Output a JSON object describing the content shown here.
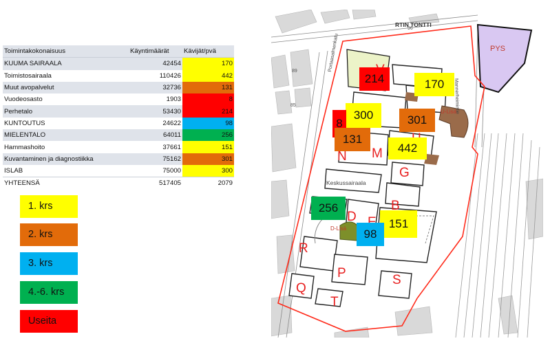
{
  "table": {
    "headers": [
      "Toimintakokonaisuus",
      "Käyntimäärät",
      "Kävijät/pvä"
    ],
    "rows": [
      {
        "name": "KUUMA SAIRAALA",
        "visits": "42454",
        "per_day": "170",
        "color": "#ffff00"
      },
      {
        "name": "Toimistosairaala",
        "visits": "110426",
        "per_day": "442",
        "color": "#ffff00"
      },
      {
        "name": "Muut avopalvelut",
        "visits": "32736",
        "per_day": "131",
        "color": "#e26b0a"
      },
      {
        "name": "Vuodeosasto",
        "visits": "1903",
        "per_day": "8",
        "color": "#ff0000"
      },
      {
        "name": "Perhetalo",
        "visits": "53430",
        "per_day": "214",
        "color": "#ff0000"
      },
      {
        "name": "KUNTOUTUS",
        "visits": "24622",
        "per_day": "98",
        "color": "#00b0f0"
      },
      {
        "name": "MIELENTALO",
        "visits": "64011",
        "per_day": "256",
        "color": "#00b050"
      },
      {
        "name": "Hammashoito",
        "visits": "37661",
        "per_day": "151",
        "color": "#ffff00"
      },
      {
        "name": "Kuvantaminen ja diagnostiikka",
        "visits": "75162",
        "per_day": "301",
        "color": "#e26b0a"
      },
      {
        "name": "ISLAB",
        "visits": "75000",
        "per_day": "300",
        "color": "#ffff00"
      }
    ],
    "total": {
      "name": "YHTEENSÄ",
      "visits": "517405",
      "per_day": "2079"
    }
  },
  "legend": [
    {
      "label": "1. krs",
      "color": "#ffff00"
    },
    {
      "label": "2. krs",
      "color": "#e26b0a"
    },
    {
      "label": "3. krs",
      "color": "#00b0f0"
    },
    {
      "label": "4.-6. krs",
      "color": "#00b050"
    },
    {
      "label": "Useita",
      "color": "#ff0000"
    }
  ],
  "map": {
    "street_top": "RTIN TONTTI",
    "street_left": "Portaasalmenkatu",
    "street_right": "Mannerheimintie",
    "area_label": "PYS",
    "hospital_label": "Keskussairaala",
    "lisa_labels": [
      "U-Lisä",
      "D-Lisä"
    ],
    "building_letters": [
      "V",
      "U",
      "N",
      "M",
      "G",
      "B",
      "D",
      "E",
      "R",
      "P",
      "Q",
      "T",
      "S"
    ],
    "plot_numbers": [
      "89",
      "85",
      "96"
    ],
    "value_boxes": [
      {
        "value": "214",
        "color": "#ff0000"
      },
      {
        "value": "170",
        "color": "#ffff00"
      },
      {
        "value": "300",
        "color": "#ffff00"
      },
      {
        "value": "8",
        "color": "#ff0000"
      },
      {
        "value": "301",
        "color": "#e26b0a"
      },
      {
        "value": "131",
        "color": "#e26b0a"
      },
      {
        "value": "442",
        "color": "#ffff00"
      },
      {
        "value": "256",
        "color": "#00b050"
      },
      {
        "value": "151",
        "color": "#ffff00"
      },
      {
        "value": "98",
        "color": "#00b0f0"
      }
    ]
  }
}
